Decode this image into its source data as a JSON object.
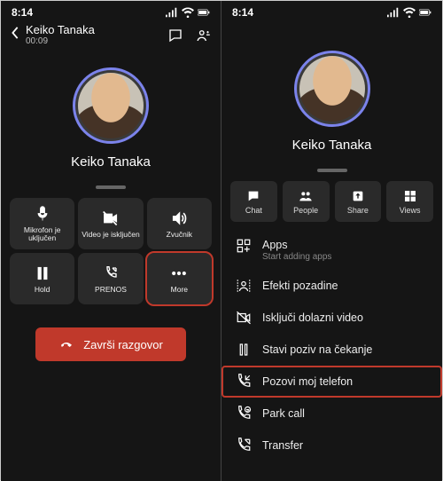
{
  "status": {
    "time": "8:14"
  },
  "left": {
    "caller_name": "Keiko Tanaka",
    "duration": "00:09",
    "display_name": "Keiko Tanaka",
    "controls": {
      "mic": "Mikrofon je uključen",
      "video": "Video je isključen",
      "speaker": "Zvučnik",
      "hold": "Hold",
      "transfer": "PRENOS",
      "more": "More"
    },
    "end_call": "Završi razgovor"
  },
  "right": {
    "display_name": "Keiko Tanaka",
    "tabs": {
      "chat": "Chat",
      "people": "People",
      "share": "Share",
      "views": "Views"
    },
    "menu": {
      "apps": "Apps",
      "apps_sub": "Start adding apps",
      "bg": "Efekti pozadine",
      "novid": "Isključi dolazni video",
      "hold": "Stavi poziv na čekanje",
      "callme": "Pozovi moj telefon",
      "park": "Park call",
      "transfer": "Transfer"
    }
  }
}
